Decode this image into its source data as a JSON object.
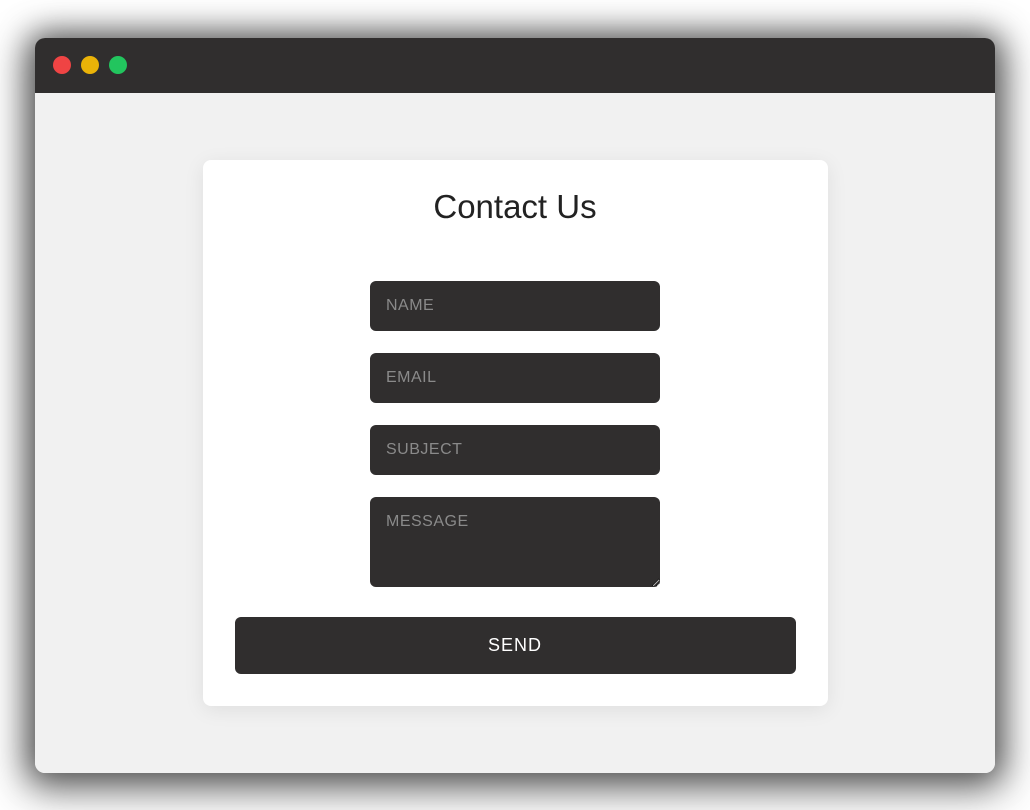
{
  "form": {
    "title": "Contact Us",
    "name_placeholder": "NAME",
    "email_placeholder": "EMAIL",
    "subject_placeholder": "SUBJECT",
    "message_placeholder": "MESSAGE",
    "submit_label": "SEND"
  }
}
